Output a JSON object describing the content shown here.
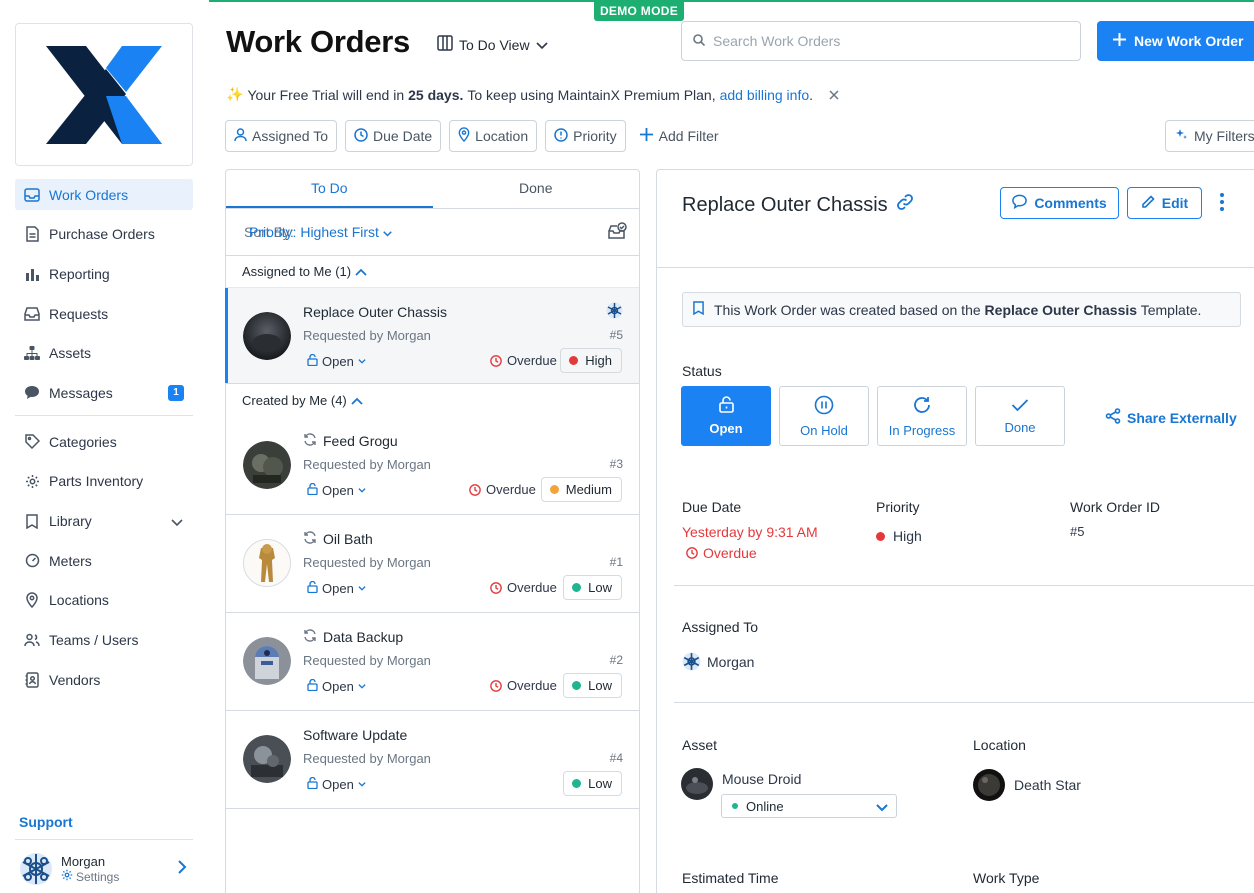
{
  "demo_label": "DEMO MODE",
  "sidebar": {
    "items": [
      {
        "label": "Work Orders",
        "icon": "inbox-icon"
      },
      {
        "label": "Purchase Orders",
        "icon": "document-icon"
      },
      {
        "label": "Reporting",
        "icon": "bar-chart-icon"
      },
      {
        "label": "Requests",
        "icon": "tray-icon"
      },
      {
        "label": "Assets",
        "icon": "hierarchy-icon"
      },
      {
        "label": "Messages",
        "icon": "chat-icon",
        "badge": "1"
      },
      {
        "label": "Categories",
        "icon": "tag-icon"
      },
      {
        "label": "Parts Inventory",
        "icon": "gear-icon"
      },
      {
        "label": "Library",
        "icon": "bookmark-icon"
      },
      {
        "label": "Meters",
        "icon": "gauge-icon"
      },
      {
        "label": "Locations",
        "icon": "map-pin-icon"
      },
      {
        "label": "Teams / Users",
        "icon": "users-icon"
      },
      {
        "label": "Vendors",
        "icon": "address-book-icon"
      }
    ],
    "support_label": "Support",
    "user": {
      "name": "Morgan",
      "settings_label": "Settings"
    }
  },
  "header": {
    "title": "Work Orders",
    "view_label": "To Do View",
    "search_placeholder": "Search Work Orders",
    "new_button": "New Work Order",
    "trial": {
      "prefix": "Your Free Trial will end in",
      "days": "25 days.",
      "middle": "To keep using MaintainX Premium Plan,",
      "link": "add billing info",
      "suffix": "."
    },
    "filters": [
      "Assigned To",
      "Due Date",
      "Location",
      "Priority"
    ],
    "add_filter": "Add Filter",
    "my_filters": "My Filters"
  },
  "list": {
    "tabs": [
      "To Do",
      "Done"
    ],
    "sort_label": "Sort By:",
    "sort_value": "Priority: Highest First",
    "groups": {
      "assigned": "Assigned to Me (1)",
      "created": "Created by Me (4)"
    },
    "requested_by": "Requested by Morgan",
    "open_label": "Open",
    "overdue_label": "Overdue",
    "orders": [
      {
        "title": "Replace Outer Chassis",
        "num": "#5",
        "overdue": true,
        "priority": "High",
        "priority_color": "#e5383b",
        "recurring": false
      },
      {
        "title": "Feed Grogu",
        "num": "#3",
        "overdue": true,
        "priority": "Medium",
        "priority_color": "#f2a33a",
        "recurring": true
      },
      {
        "title": "Oil Bath",
        "num": "#1",
        "overdue": true,
        "priority": "Low",
        "priority_color": "#1fb58f",
        "recurring": true
      },
      {
        "title": "Data Backup",
        "num": "#2",
        "overdue": true,
        "priority": "Low",
        "priority_color": "#1fb58f",
        "recurring": true
      },
      {
        "title": "Software Update",
        "num": "#4",
        "overdue": false,
        "priority": "Low",
        "priority_color": "#1fb58f",
        "recurring": false
      }
    ]
  },
  "detail": {
    "title": "Replace Outer Chassis",
    "comments": "Comments",
    "edit": "Edit",
    "note": {
      "prefix": "This Work Order was created based on the",
      "name": "Replace Outer Chassis",
      "suffix": "Template."
    },
    "status_label": "Status",
    "statuses": [
      "Open",
      "On Hold",
      "In Progress",
      "Done"
    ],
    "share": "Share Externally",
    "due_date_label": "Due Date",
    "due_date_value": "Yesterday by 9:31 AM",
    "due_overdue": "Overdue",
    "priority_label": "Priority",
    "priority_value": "High",
    "id_label": "Work Order ID",
    "id_value": "#5",
    "assigned_label": "Assigned To",
    "assigned_value": "Morgan",
    "asset_label": "Asset",
    "asset_value": "Mouse Droid",
    "asset_status": "Online",
    "location_label": "Location",
    "location_value": "Death Star",
    "est_time_label": "Estimated Time",
    "work_type_label": "Work Type"
  },
  "colors": {
    "accent": "#1a82f2",
    "demo": "#1dae72",
    "overdue": "#e5383b"
  }
}
